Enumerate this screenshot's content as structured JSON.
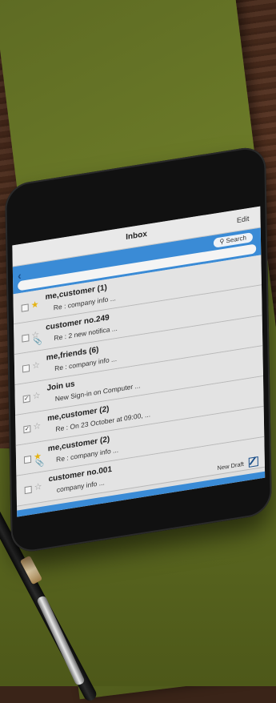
{
  "header": {
    "title": "Inbox",
    "edit_label": "Edit"
  },
  "search": {
    "label": "Search",
    "back_icon": "chevron-left-icon",
    "search_icon": "magnifier-icon"
  },
  "messages": [
    {
      "sender": "me,customer (1)",
      "preview": "Re : company info ...",
      "starred": true,
      "checked": false,
      "attachment": false
    },
    {
      "sender": "customer no.249",
      "preview": "Re : 2 new notifica ...",
      "starred": false,
      "checked": false,
      "attachment": true
    },
    {
      "sender": "me,friends (6)",
      "preview": "Re : company info ...",
      "starred": false,
      "checked": false,
      "attachment": false
    },
    {
      "sender": "Join us",
      "preview": "New Sign-in on Computer ...",
      "starred": false,
      "checked": true,
      "attachment": false
    },
    {
      "sender": "me,customer (2)",
      "preview": "Re : On 23 October at 09:00, ...",
      "starred": false,
      "checked": true,
      "attachment": false
    },
    {
      "sender": "me,customer (2)",
      "preview": "Re : company info ...",
      "starred": true,
      "checked": false,
      "attachment": true
    },
    {
      "sender": "customer no.001",
      "preview": "company info ...",
      "starred": false,
      "checked": false,
      "attachment": false
    }
  ],
  "footer": {
    "new_draft_label": "New Draft",
    "compose_icon": "compose-icon"
  },
  "colors": {
    "accent": "#3a8bd6",
    "star": "#e5b313"
  }
}
